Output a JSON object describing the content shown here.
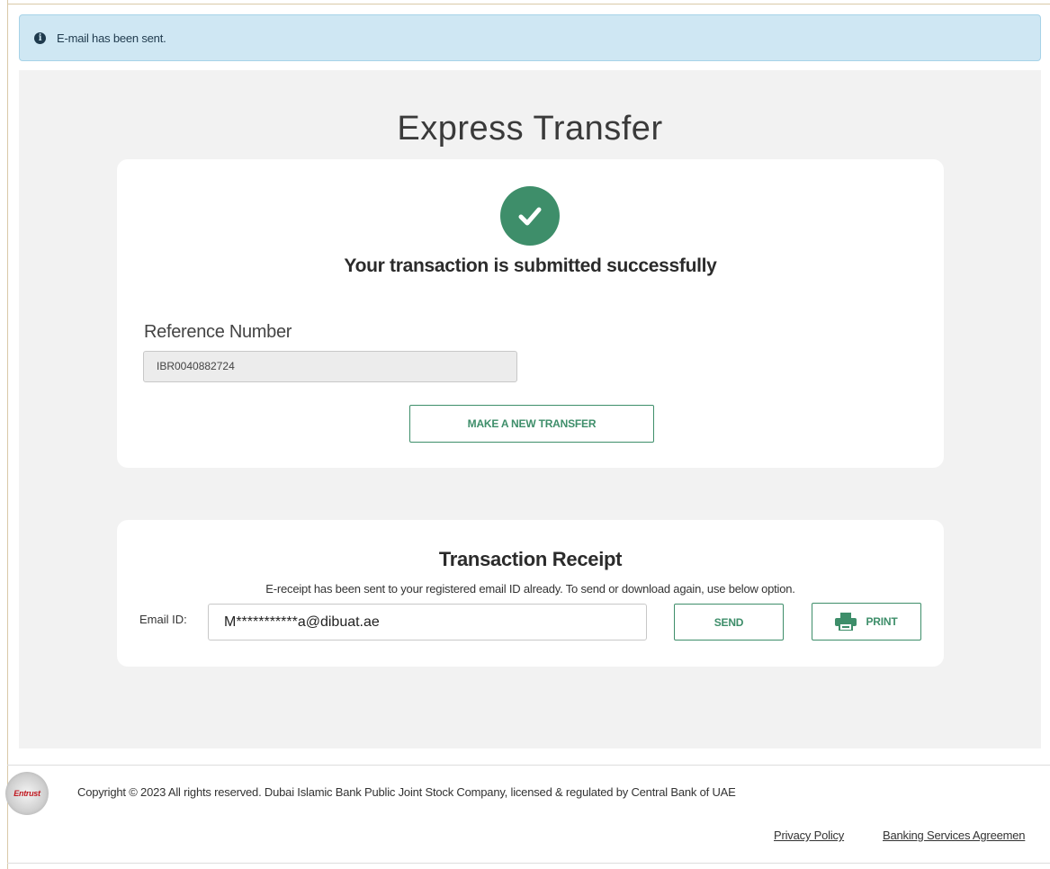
{
  "alert": {
    "message": "E-mail has been sent.",
    "icon": "info-icon"
  },
  "page": {
    "title": "Express Transfer"
  },
  "success": {
    "icon": "check-icon",
    "message": "Your transaction is submitted successfully",
    "reference_label": "Reference Number",
    "reference_value": "IBR0040882724",
    "new_transfer_button": "MAKE A NEW TRANSFER"
  },
  "receipt": {
    "title": "Transaction Receipt",
    "description": "E-receipt has been sent to your registered email ID already. To send or download again, use below option.",
    "email_label": "Email ID:",
    "email_value": "M***********a@dibuat.ae",
    "send_button": "SEND",
    "print_button": "PRINT"
  },
  "footer": {
    "seal_text": "Entrust",
    "copyright": "Copyright © 2023 All rights reserved. Dubai Islamic Bank Public Joint Stock Company, licensed & regulated by Central Bank of UAE",
    "links": [
      "Privacy Policy",
      "Banking Services Agreemen"
    ]
  },
  "colors": {
    "accent": "#3e8e6a",
    "alert_bg": "#cfe7f3",
    "panel_bg": "#f2f2f2"
  }
}
